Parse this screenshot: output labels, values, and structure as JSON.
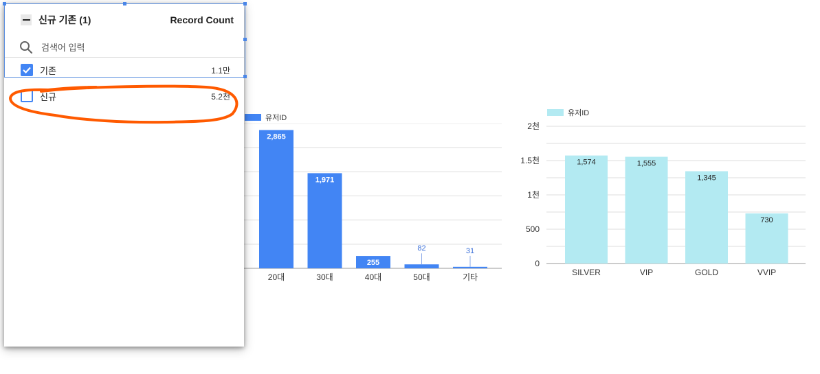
{
  "filter": {
    "title": "신규 기존 (1)",
    "metric_label": "Record Count",
    "search_placeholder": "검색어 입력",
    "options": [
      {
        "label": "기존",
        "value": "1.1만",
        "checked": true
      },
      {
        "label": "신규",
        "value": "5.2천",
        "checked": false
      }
    ]
  },
  "colors": {
    "age_bar": "#4285f4",
    "grade_bar": "#b3eaf2",
    "accent": "#4285f4",
    "annotation": "#ff5a00"
  },
  "chart_data": [
    {
      "type": "bar",
      "legend": "유저ID",
      "categories": [
        "20대",
        "30대",
        "40대",
        "50대",
        "기타"
      ],
      "values": [
        2865,
        1971,
        255,
        82,
        31
      ],
      "data_labels": [
        "2,865",
        "1,971",
        "255",
        "82",
        "31"
      ],
      "ylim": [
        0,
        3000
      ],
      "grid": true
    },
    {
      "type": "bar",
      "legend": "유저ID",
      "categories": [
        "SILVER",
        "VIP",
        "GOLD",
        "VVIP"
      ],
      "values": [
        1574,
        1555,
        1345,
        730
      ],
      "data_labels": [
        "1,574",
        "1,555",
        "1,345",
        "730"
      ],
      "yticks": [
        "0",
        "500",
        "1천",
        "1.5천",
        "2천"
      ],
      "ylim": [
        0,
        2000
      ],
      "grid": true
    }
  ]
}
